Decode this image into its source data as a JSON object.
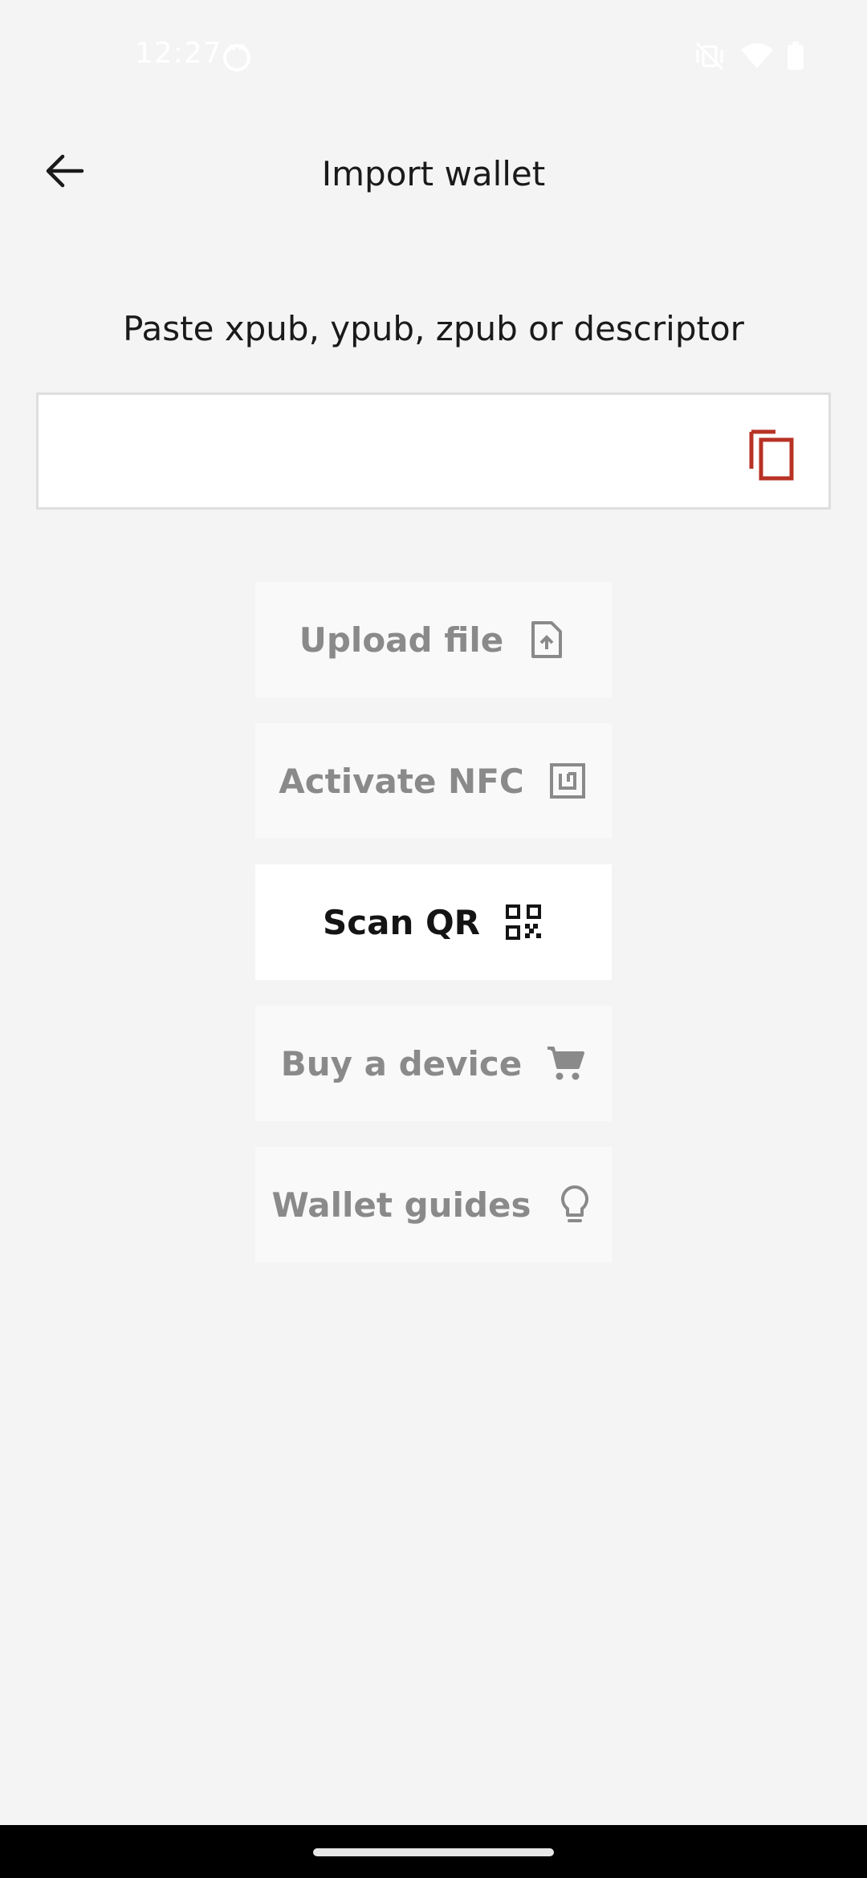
{
  "status_bar": {
    "time": "12:27",
    "icons": [
      "cat-notification-icon",
      "mute-vibrate-icon",
      "wifi-icon",
      "battery-icon"
    ]
  },
  "header": {
    "title": "Import wallet",
    "back_icon": "arrow-left-icon"
  },
  "main": {
    "prompt": "Paste xpub, ypub, zpub or descriptor",
    "input": {
      "value": "",
      "placeholder": ""
    },
    "paste_icon": "copy-icon",
    "accent_color": "#c0392b",
    "buttons": [
      {
        "label": "Upload file",
        "icon": "file-upload-icon",
        "state": "disabled"
      },
      {
        "label": "Activate NFC",
        "icon": "nfc-icon",
        "state": "disabled"
      },
      {
        "label": "Scan QR",
        "icon": "qr-code-icon",
        "state": "enabled"
      },
      {
        "label": "Buy a device",
        "icon": "cart-icon",
        "state": "disabled"
      },
      {
        "label": "Wallet guides",
        "icon": "lightbulb-icon",
        "state": "disabled"
      }
    ]
  }
}
